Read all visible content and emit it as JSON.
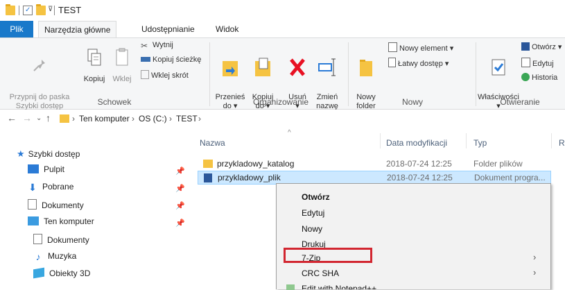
{
  "window": {
    "title": "TEST"
  },
  "tabs": [
    "Plik",
    "Narzędzia główne",
    "Udostępnianie",
    "Widok"
  ],
  "ribbon": {
    "clipboard": {
      "group": "Schowek",
      "pin": "Przypnij do paska\nSzybki dostęp",
      "copy": "Kopiuj",
      "paste": "Wklej",
      "cut": "Wytnij",
      "copy_path": "Kopiuj ścieżkę",
      "paste_shortcut": "Wklej skrót"
    },
    "organize": {
      "group": "Organizowanie",
      "move_to": "Przenieś\ndo ▾",
      "copy_to": "Kopiuj\ndo ▾",
      "delete": "Usuń\n▾",
      "rename": "Zmień\nnazwę"
    },
    "new": {
      "group": "Nowy",
      "new_folder": "Nowy\nfolder",
      "new_item": "Nowy element ▾",
      "easy_access": "Łatwy dostęp ▾"
    },
    "open": {
      "group": "Otwieranie",
      "properties": "Właściwości\n▾",
      "open": "Otwórz ▾",
      "edit": "Edytuj",
      "history": "Historia"
    }
  },
  "address": {
    "crumbs": [
      "Ten komputer",
      "OS (C:)",
      "TEST"
    ]
  },
  "nav": {
    "quick_access": "Szybki dostęp",
    "items": [
      {
        "label": "Pulpit",
        "pinned": true
      },
      {
        "label": "Pobrane",
        "pinned": true
      },
      {
        "label": "Dokumenty",
        "pinned": true
      },
      {
        "label": "Ten komputer",
        "pinned": true
      },
      {
        "label": "Dokumenty",
        "pinned": false
      },
      {
        "label": "Muzyka",
        "pinned": false
      },
      {
        "label": "Obiekty 3D",
        "pinned": false
      }
    ]
  },
  "columns": {
    "name": "Nazwa",
    "date": "Data modyfikacji",
    "type": "Typ",
    "size": "R"
  },
  "files": [
    {
      "name": "przykladowy_katalog",
      "date": "2018-07-24 12:25",
      "type": "Folder plików",
      "icon": "folder-icon",
      "selected": false
    },
    {
      "name": "przykladowy_plik",
      "date": "2018-07-24 12:25",
      "type": "Dokument progra...",
      "icon": "word-document-icon",
      "selected": true
    }
  ],
  "context_menu": {
    "items": [
      "Otwórz",
      "Edytuj",
      "Nowy",
      "Drukuj",
      "7-Zip",
      "CRC SHA"
    ],
    "partial_item": "Edit with Notepad++",
    "highlighted": "7-Zip",
    "highlight_color": "#d22630"
  },
  "colors": {
    "accent": "#1979ca",
    "selection": "#cce8ff",
    "folder": "#f5c342"
  }
}
